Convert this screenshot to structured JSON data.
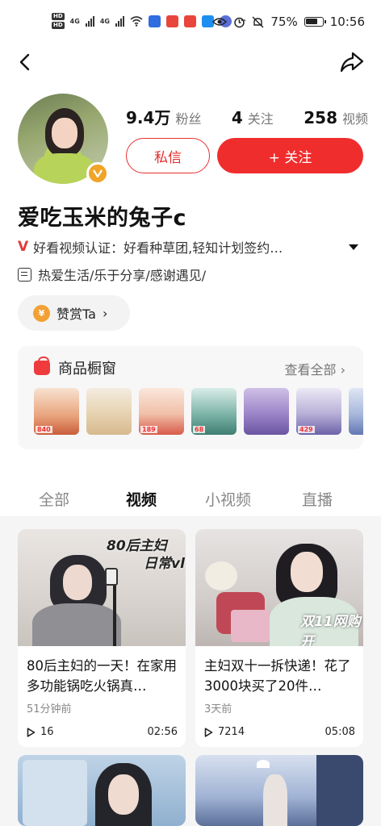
{
  "status_bar": {
    "hd1": "HD",
    "hd2": "HD",
    "net1": "4G",
    "net2": "4G",
    "battery": "75%",
    "time": "10:56"
  },
  "profile": {
    "fans_count": "9.4万",
    "fans_label": "粉丝",
    "follow_count": "4",
    "follow_label": "关注",
    "video_count": "258",
    "video_label": "视频",
    "message_button": "私信",
    "follow_button": "+ 关注",
    "username": "爱吃玉米的兔子c",
    "cert_mark": "V",
    "cert_text": "好看视频认证：好看种草团,轻知计划签约…",
    "bio": "热爱生活/乐于分享/感谢遇见/",
    "tip_coin": "¥",
    "tip_label": "赞赏Ta",
    "tip_arrow": "›"
  },
  "shop": {
    "title": "商品橱窗",
    "view_all": "查看全部 ›",
    "items": [
      {
        "price": "840",
        "color": "#f2c9a0"
      },
      {
        "price": "",
        "color": "#efe2c9"
      },
      {
        "price": "189",
        "color": "#f4d7c2"
      },
      {
        "price": "68",
        "color": "#cfe3dc"
      },
      {
        "price": "",
        "color": "#b8a3d6"
      },
      {
        "price": "429",
        "color": "#e4e0f0"
      },
      {
        "price": "",
        "color": "#d6e0f2"
      }
    ]
  },
  "tabs": [
    "全部",
    "视频",
    "小视频",
    "直播"
  ],
  "videos": [
    {
      "overlay1": "80后主妇",
      "overlay2": "日常vl",
      "title": "80后主妇的一天！在家用多功能锅吃火锅真…",
      "time": "51分钟前",
      "plays": "16",
      "duration": "02:56"
    },
    {
      "overlay1": "双11网购开",
      "overlay2": "",
      "title": "主妇双十一拆快递！花了3000块买了20件…",
      "time": "3天前",
      "plays": "7214",
      "duration": "05:08"
    }
  ]
}
